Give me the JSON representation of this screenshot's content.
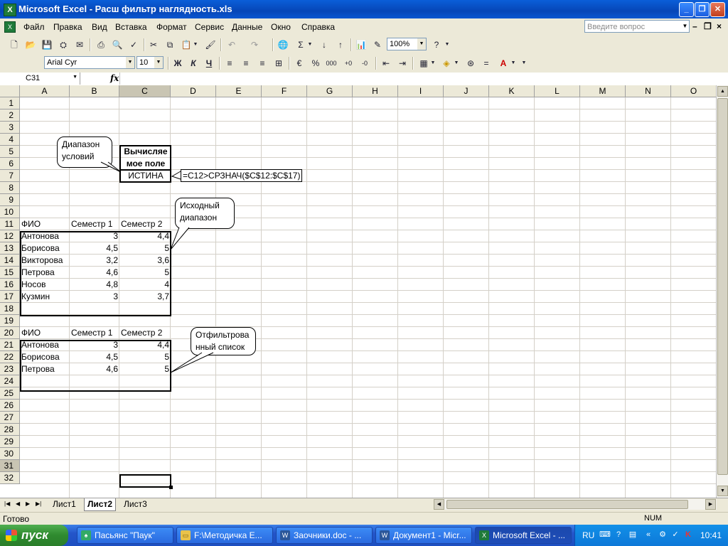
{
  "window": {
    "title": "Microsoft Excel - Расш фильтр наглядность.xls"
  },
  "menu": [
    "Файл",
    "Правка",
    "Вид",
    "Вставка",
    "Формат",
    "Сервис",
    "Данные",
    "Окно",
    "Справка"
  ],
  "help_placeholder": "Введите вопрос",
  "toolbar": {
    "zoom": "100%",
    "font": "Arial Cyr",
    "size": "10"
  },
  "formula_bar": {
    "name_box": "C31",
    "fx": "fx"
  },
  "columns": [
    "A",
    "B",
    "C",
    "D",
    "E",
    "F",
    "G",
    "H",
    "I",
    "J",
    "K",
    "L",
    "M",
    "N",
    "O"
  ],
  "rows": [
    "1",
    "2",
    "3",
    "4",
    "5",
    "6",
    "7",
    "8",
    "9",
    "10",
    "11",
    "12",
    "13",
    "14",
    "15",
    "16",
    "17",
    "18",
    "19",
    "20",
    "21",
    "22",
    "23",
    "24",
    "25",
    "26",
    "27",
    "28",
    "29",
    "30",
    "31",
    "32"
  ],
  "criteria": {
    "header_line1": "Вычисляе",
    "header_line2": "мое поле",
    "value": "ИСТИНА",
    "formula": "=C12>СРЗНАЧ($C$12:$C$17)"
  },
  "source_table": {
    "headers": [
      "ФИО",
      "Семестр 1",
      "Семестр 2"
    ],
    "rows": [
      [
        "Антонова",
        "3",
        "4,4"
      ],
      [
        "Борисова",
        "4,5",
        "5"
      ],
      [
        "Викторова",
        "3,2",
        "3,6"
      ],
      [
        "Петрова",
        "4,6",
        "5"
      ],
      [
        "Носов",
        "4,8",
        "4"
      ],
      [
        "Кузмин",
        "3",
        "3,7"
      ]
    ]
  },
  "filtered_table": {
    "headers": [
      "ФИО",
      "Семестр 1",
      "Семестр 2"
    ],
    "rows": [
      [
        "Антонова",
        "3",
        "4,4"
      ],
      [
        "Борисова",
        "4,5",
        "5"
      ],
      [
        "Петрова",
        "4,6",
        "5"
      ]
    ]
  },
  "callouts": {
    "criteria": [
      "Диапазон",
      "условий"
    ],
    "source": [
      "Исходный",
      "диапазон"
    ],
    "filtered": [
      "Отфильтрова",
      "нный список"
    ]
  },
  "sheets": [
    "Лист1",
    "Лист2",
    "Лист3"
  ],
  "status": {
    "ready": "Готово",
    "num": "NUM"
  },
  "taskbar": {
    "start": "пуск",
    "items": [
      "Пасьянс \"Паук\"",
      "F:\\Методичка E...",
      "Заочники.doc - ...",
      "Документ1 - Micr...",
      "Microsoft Excel - ..."
    ],
    "lang": "RU",
    "clock": "10:41"
  },
  "colors": {
    "title_blue": "#0a5fd8",
    "excel_green": "#1f7a3a",
    "start_green": "#2f8a2f"
  }
}
